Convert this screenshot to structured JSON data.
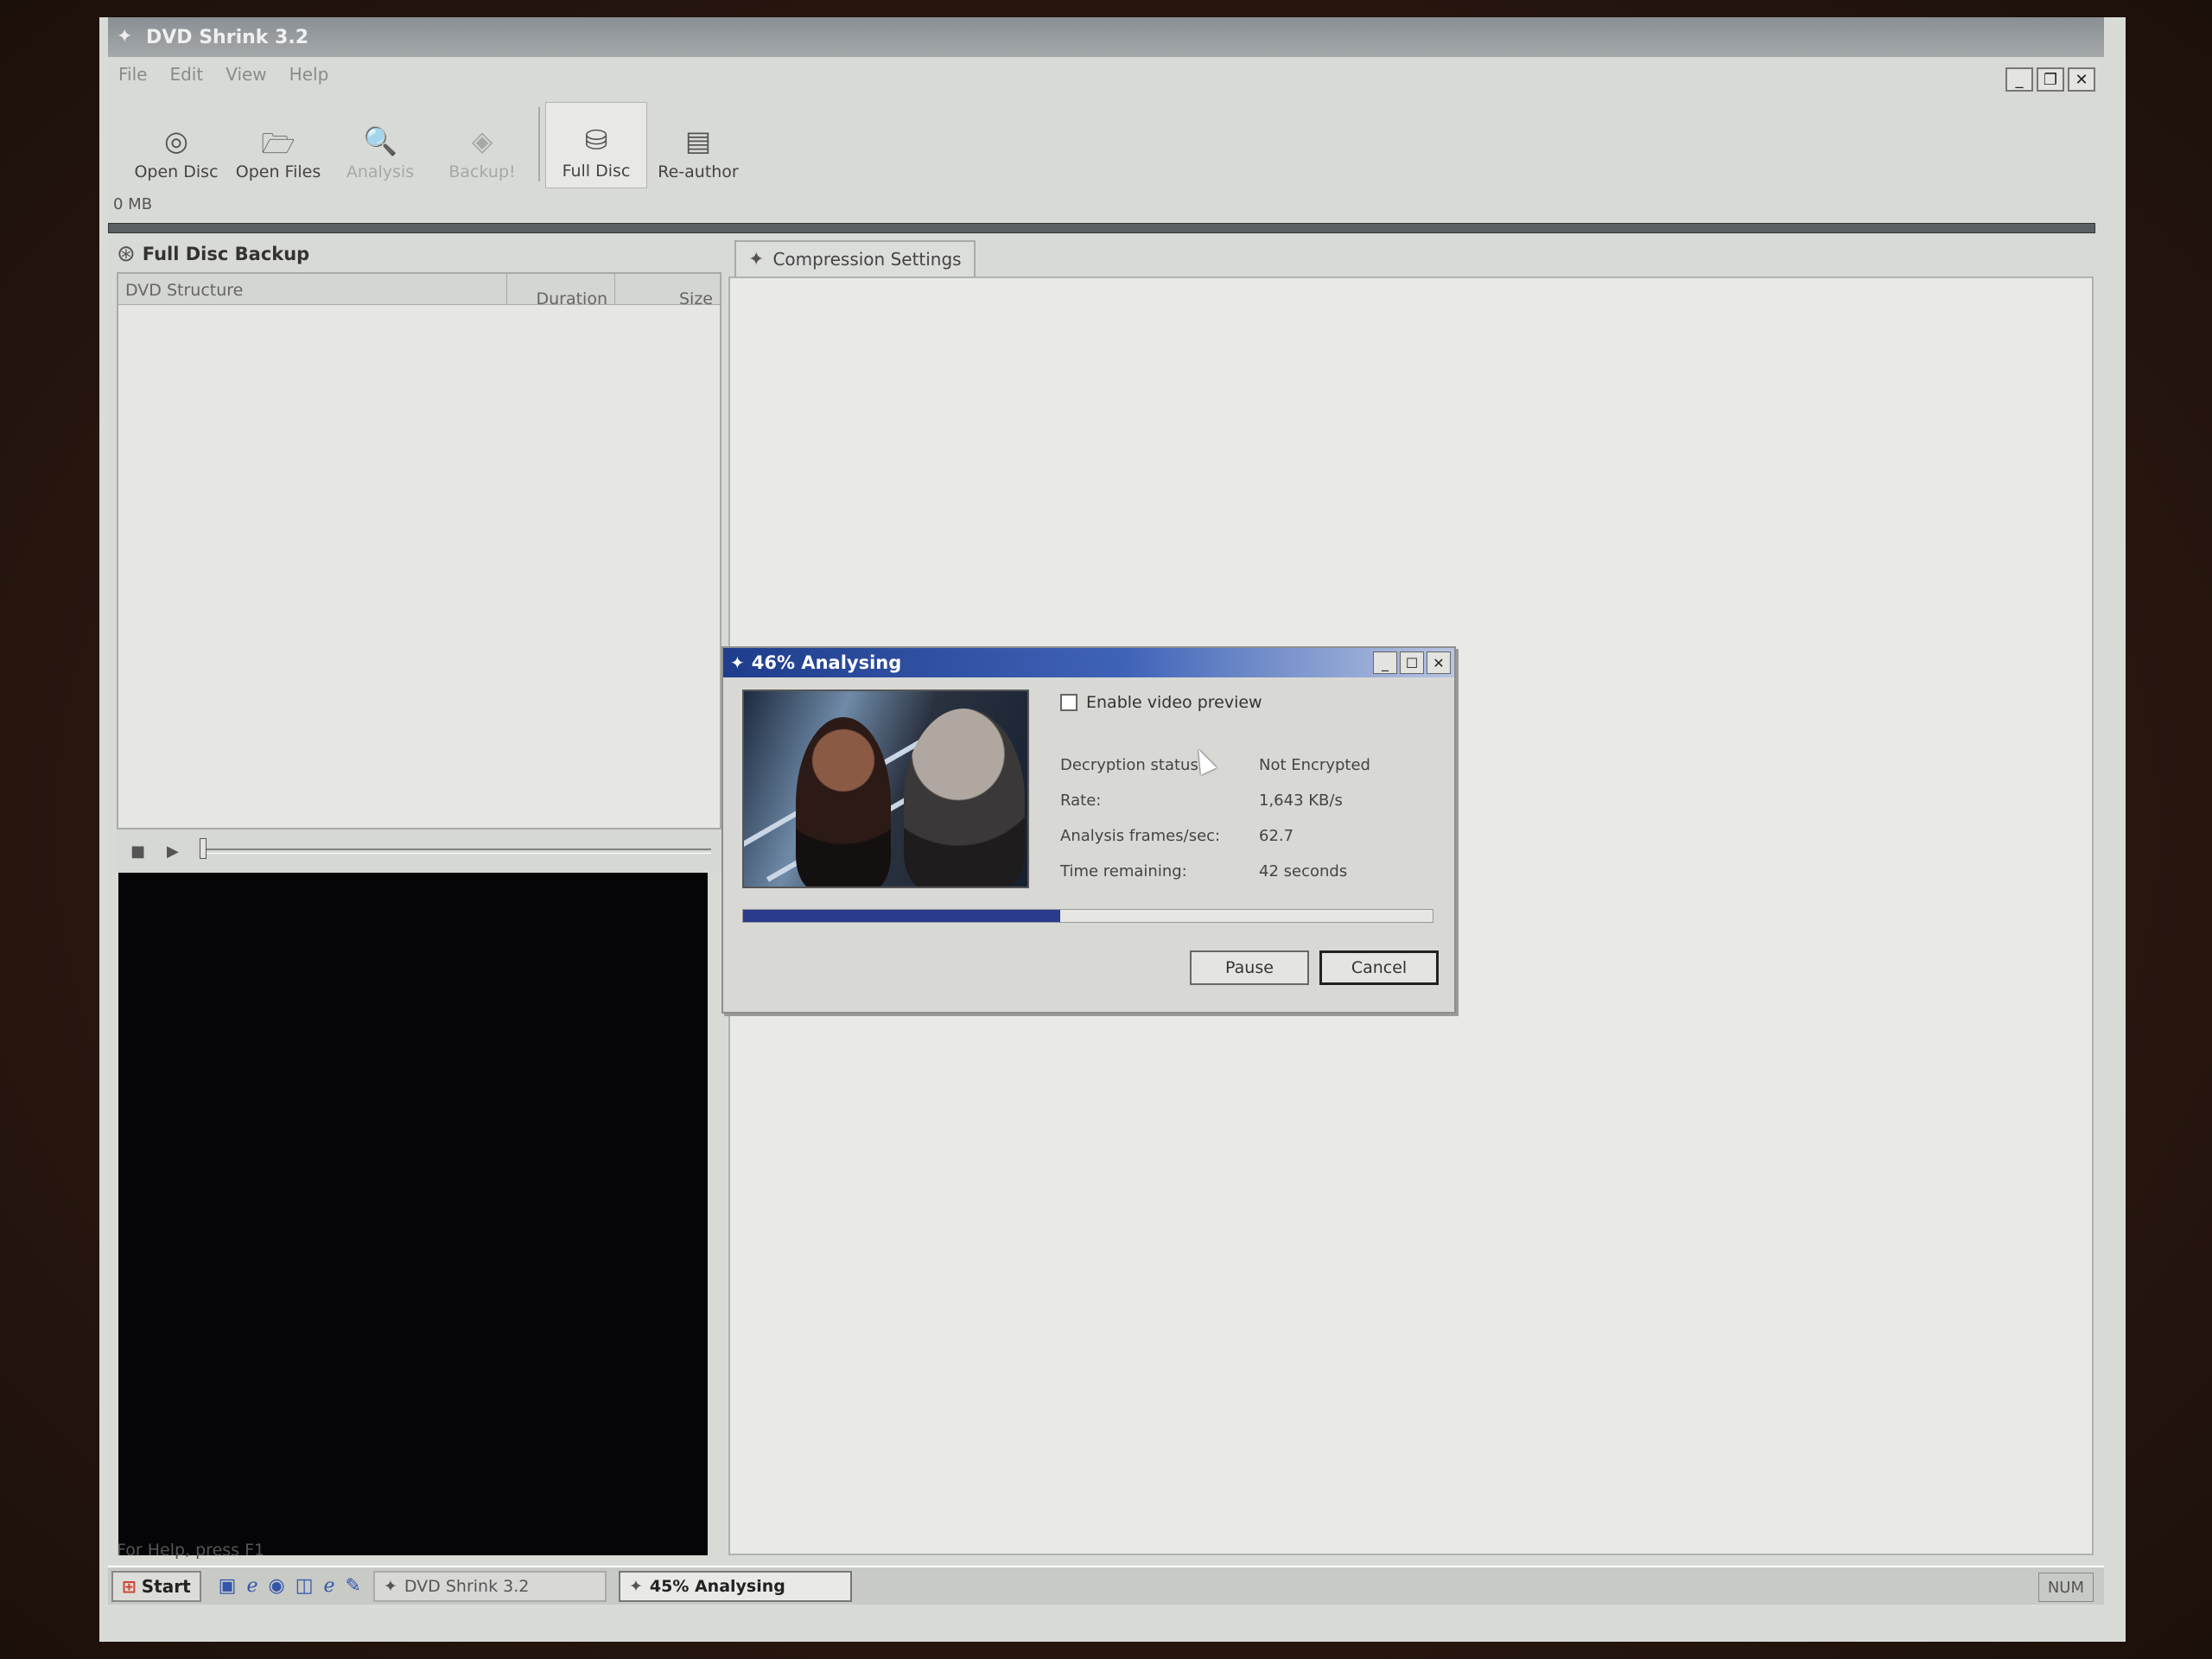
{
  "window": {
    "title": "DVD Shrink 3.2"
  },
  "menu": [
    "File",
    "Edit",
    "View",
    "Help"
  ],
  "toolbar": {
    "open_disc": "Open Disc",
    "open_files": "Open Files",
    "analysis": "Analysis",
    "backup": "Backup!",
    "full_disc": "Full Disc",
    "re_author": "Re-author"
  },
  "size_readout": "0 MB",
  "left_pane": {
    "title": "Full Disc Backup",
    "columns": [
      "DVD Structure",
      "Duration",
      "Size"
    ]
  },
  "right_pane": {
    "tab": "Compression Settings"
  },
  "dialog": {
    "title": "46% Analysing",
    "preview_checkbox": "Enable video preview",
    "preview_checked": false,
    "rows": [
      {
        "label": "Decryption status:",
        "value": "Not Encrypted"
      },
      {
        "label": "Rate:",
        "value": "1,643 KB/s"
      },
      {
        "label": "Analysis frames/sec:",
        "value": "62.7"
      },
      {
        "label": "Time remaining:",
        "value": "42 seconds"
      }
    ],
    "progress": 0.46,
    "pause": "Pause",
    "cancel": "Cancel"
  },
  "status_bar": "For Help, press F1",
  "taskbar": {
    "start": "Start",
    "tasks": [
      "DVD Shrink 3.2",
      "45% Analysing"
    ],
    "tray": "NUM"
  },
  "colors": {
    "dialog_title": "#1f3d8c",
    "progress_fill": "#2a3a8c",
    "video_bg": "#050406"
  }
}
